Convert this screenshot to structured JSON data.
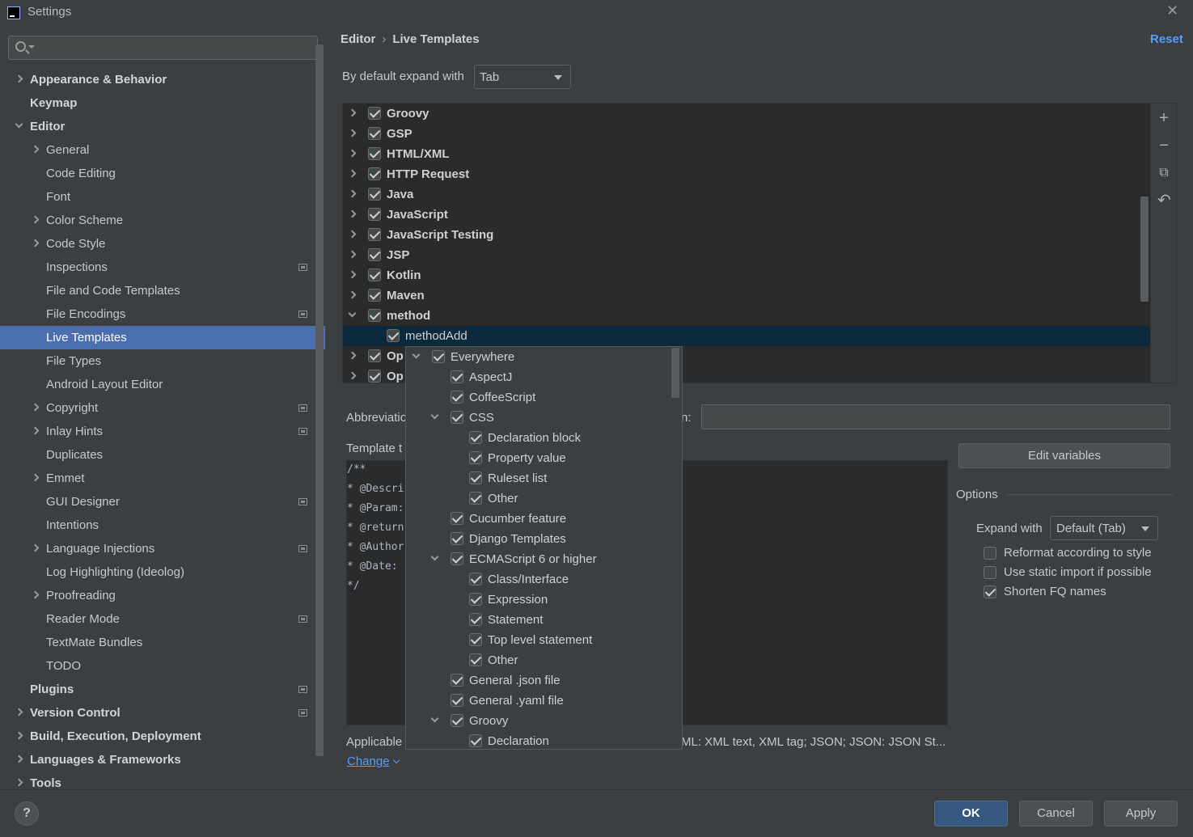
{
  "window": {
    "title": "Settings"
  },
  "sidebar": {
    "search_placeholder": "",
    "items": [
      {
        "label": "Appearance & Behavior",
        "level": 0,
        "bold": true,
        "chevron": "right",
        "proj": false
      },
      {
        "label": "Keymap",
        "level": 0,
        "bold": true,
        "chevron": "none",
        "proj": false
      },
      {
        "label": "Editor",
        "level": 0,
        "bold": true,
        "chevron": "down",
        "proj": false
      },
      {
        "label": "General",
        "level": 1,
        "bold": false,
        "chevron": "right",
        "proj": false
      },
      {
        "label": "Code Editing",
        "level": 1,
        "bold": false,
        "chevron": "none",
        "proj": false
      },
      {
        "label": "Font",
        "level": 1,
        "bold": false,
        "chevron": "none",
        "proj": false
      },
      {
        "label": "Color Scheme",
        "level": 1,
        "bold": false,
        "chevron": "right",
        "proj": false
      },
      {
        "label": "Code Style",
        "level": 1,
        "bold": false,
        "chevron": "right",
        "proj": false
      },
      {
        "label": "Inspections",
        "level": 1,
        "bold": false,
        "chevron": "none",
        "proj": true
      },
      {
        "label": "File and Code Templates",
        "level": 1,
        "bold": false,
        "chevron": "none",
        "proj": false
      },
      {
        "label": "File Encodings",
        "level": 1,
        "bold": false,
        "chevron": "none",
        "proj": true
      },
      {
        "label": "Live Templates",
        "level": 1,
        "bold": false,
        "chevron": "none",
        "proj": false,
        "selected": true
      },
      {
        "label": "File Types",
        "level": 1,
        "bold": false,
        "chevron": "none",
        "proj": false
      },
      {
        "label": "Android Layout Editor",
        "level": 1,
        "bold": false,
        "chevron": "none",
        "proj": false
      },
      {
        "label": "Copyright",
        "level": 1,
        "bold": false,
        "chevron": "right",
        "proj": true
      },
      {
        "label": "Inlay Hints",
        "level": 1,
        "bold": false,
        "chevron": "right",
        "proj": true
      },
      {
        "label": "Duplicates",
        "level": 1,
        "bold": false,
        "chevron": "none",
        "proj": false
      },
      {
        "label": "Emmet",
        "level": 1,
        "bold": false,
        "chevron": "right",
        "proj": false
      },
      {
        "label": "GUI Designer",
        "level": 1,
        "bold": false,
        "chevron": "none",
        "proj": true
      },
      {
        "label": "Intentions",
        "level": 1,
        "bold": false,
        "chevron": "none",
        "proj": false
      },
      {
        "label": "Language Injections",
        "level": 1,
        "bold": false,
        "chevron": "right",
        "proj": true
      },
      {
        "label": "Log Highlighting (Ideolog)",
        "level": 1,
        "bold": false,
        "chevron": "none",
        "proj": false
      },
      {
        "label": "Proofreading",
        "level": 1,
        "bold": false,
        "chevron": "right",
        "proj": false
      },
      {
        "label": "Reader Mode",
        "level": 1,
        "bold": false,
        "chevron": "none",
        "proj": true
      },
      {
        "label": "TextMate Bundles",
        "level": 1,
        "bold": false,
        "chevron": "none",
        "proj": false
      },
      {
        "label": "TODO",
        "level": 1,
        "bold": false,
        "chevron": "none",
        "proj": false
      },
      {
        "label": "Plugins",
        "level": 0,
        "bold": true,
        "chevron": "none",
        "proj": true
      },
      {
        "label": "Version Control",
        "level": 0,
        "bold": true,
        "chevron": "right",
        "proj": true
      },
      {
        "label": "Build, Execution, Deployment",
        "level": 0,
        "bold": true,
        "chevron": "right",
        "proj": false
      },
      {
        "label": "Languages & Frameworks",
        "level": 0,
        "bold": true,
        "chevron": "right",
        "proj": false
      },
      {
        "label": "Tools",
        "level": 0,
        "bold": true,
        "chevron": "right",
        "proj": false
      }
    ]
  },
  "header": {
    "crumb1": "Editor",
    "crumb_sep": "›",
    "crumb2": "Live Templates",
    "reset": "Reset"
  },
  "expand": {
    "label": "By default expand with",
    "value": "Tab"
  },
  "templates": [
    {
      "label": "Groovy",
      "group": true,
      "chevron": "right",
      "checked": true
    },
    {
      "label": "GSP",
      "group": true,
      "chevron": "right",
      "checked": true
    },
    {
      "label": "HTML/XML",
      "group": true,
      "chevron": "right",
      "checked": true
    },
    {
      "label": "HTTP Request",
      "group": true,
      "chevron": "right",
      "checked": true
    },
    {
      "label": "Java",
      "group": true,
      "chevron": "right",
      "checked": true
    },
    {
      "label": "JavaScript",
      "group": true,
      "chevron": "right",
      "checked": true
    },
    {
      "label": "JavaScript Testing",
      "group": true,
      "chevron": "right",
      "checked": true
    },
    {
      "label": "JSP",
      "group": true,
      "chevron": "right",
      "checked": true
    },
    {
      "label": "Kotlin",
      "group": true,
      "chevron": "right",
      "checked": true
    },
    {
      "label": "Maven",
      "group": true,
      "chevron": "right",
      "checked": true
    },
    {
      "label": "method",
      "group": true,
      "chevron": "down",
      "checked": true
    },
    {
      "label": "methodAdd",
      "group": false,
      "chevron": "none",
      "checked": true,
      "selected": true
    },
    {
      "label": "Op",
      "group": true,
      "chevron": "right",
      "checked": true
    },
    {
      "label": "Op",
      "group": true,
      "chevron": "right",
      "checked": true
    }
  ],
  "toolbar": {
    "add": "+",
    "remove": "−",
    "copy": "⧉",
    "restore": "↶"
  },
  "form": {
    "abbrev_label": "Abbreviatio",
    "desc_colon": "n:",
    "template_text_label": "Template t",
    "code_lines": [
      "/**",
      "* @Descri",
      "* @Param:",
      "* @return",
      "* @Author",
      "* @Date:",
      "*/"
    ],
    "edit_variables": "Edit variables",
    "options_label": "Options",
    "expand_with_label": "Expand with",
    "expand_with_value": "Default (Tab)",
    "options": [
      {
        "label": "Reformat according to style",
        "checked": false
      },
      {
        "label": "Use static import if possible",
        "checked": false
      },
      {
        "label": "Shorten FQ names",
        "checked": true
      }
    ],
    "applicable": "Applicable",
    "applicable_rest": "ML: XML text, XML tag; JSON; JSON: JSON St...",
    "change": "Change"
  },
  "context_popup": [
    {
      "label": "Everywhere",
      "level": 0,
      "chevron": "down",
      "checked": true
    },
    {
      "label": "AspectJ",
      "level": 1,
      "chevron": "none",
      "checked": true
    },
    {
      "label": "CoffeeScript",
      "level": 1,
      "chevron": "none",
      "checked": true
    },
    {
      "label": "CSS",
      "level": 1,
      "chevron": "down",
      "checked": true
    },
    {
      "label": "Declaration block",
      "level": 2,
      "chevron": "none",
      "checked": true
    },
    {
      "label": "Property value",
      "level": 2,
      "chevron": "none",
      "checked": true
    },
    {
      "label": "Ruleset list",
      "level": 2,
      "chevron": "none",
      "checked": true
    },
    {
      "label": "Other",
      "level": 2,
      "chevron": "none",
      "checked": true
    },
    {
      "label": "Cucumber feature",
      "level": 1,
      "chevron": "none",
      "checked": true
    },
    {
      "label": "Django Templates",
      "level": 1,
      "chevron": "none",
      "checked": true
    },
    {
      "label": "ECMAScript 6 or higher",
      "level": 1,
      "chevron": "down",
      "checked": true
    },
    {
      "label": "Class/Interface",
      "level": 2,
      "chevron": "none",
      "checked": true
    },
    {
      "label": "Expression",
      "level": 2,
      "chevron": "none",
      "checked": true
    },
    {
      "label": "Statement",
      "level": 2,
      "chevron": "none",
      "checked": true
    },
    {
      "label": "Top level statement",
      "level": 2,
      "chevron": "none",
      "checked": true
    },
    {
      "label": "Other",
      "level": 2,
      "chevron": "none",
      "checked": true
    },
    {
      "label": "General .json file",
      "level": 1,
      "chevron": "none",
      "checked": true
    },
    {
      "label": "General .yaml file",
      "level": 1,
      "chevron": "none",
      "checked": true
    },
    {
      "label": "Groovy",
      "level": 1,
      "chevron": "down",
      "checked": true
    },
    {
      "label": "Declaration",
      "level": 2,
      "chevron": "none",
      "checked": true
    }
  ],
  "buttons": {
    "help": "?",
    "ok": "OK",
    "cancel": "Cancel",
    "apply": "Apply"
  },
  "colors": {
    "accent": "#589df6",
    "selection": "#4b6eaf",
    "background": "#3c3f41",
    "editor": "#2b2b2b"
  }
}
